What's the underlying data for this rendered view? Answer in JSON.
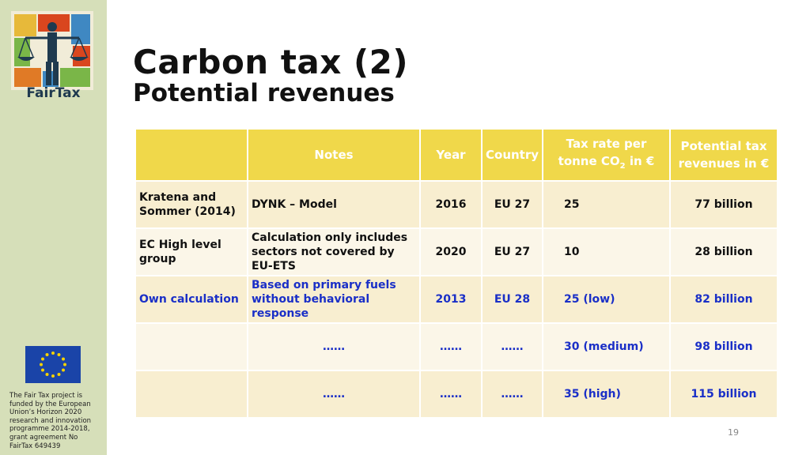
{
  "sidebar": {
    "logo_text": "FairTax",
    "funding_text": "The Fair Tax project is funded by the European Union’s Horizon 2020 research and innovation programme 2014-2018, grant agreement No FairTax 649439"
  },
  "header": {
    "title": "Carbon tax (2)",
    "subtitle": "Potential revenues"
  },
  "table": {
    "headers": {
      "col0": "",
      "notes": "Notes",
      "year": "Year",
      "country": "Country",
      "tax_rate_line1": "Tax rate per",
      "tax_rate_line2_pre": "tonne CO",
      "tax_rate_sub": "2",
      "tax_rate_line2_post": " in €",
      "revenues_line1": "Potential tax",
      "revenues_line2": "revenues in €"
    },
    "rows": [
      {
        "source": "Kratena and Sommer (2014)",
        "notes": "DYNK – Model",
        "year": "2016",
        "country": "EU 27",
        "tax_rate": "25",
        "revenues": "77 billion"
      },
      {
        "source": "EC High level group",
        "notes": "Calculation only includes sectors not covered by EU-ETS",
        "year": "2020",
        "country": "EU 27",
        "tax_rate": "10",
        "revenues": "28 billion"
      },
      {
        "source": "Own calculation",
        "notes": "Based on primary fuels without behavioral response",
        "year": "2013",
        "country": "EU 28",
        "tax_rate": "25 (low)",
        "revenues": "82 billion"
      },
      {
        "source": "",
        "notes": "……",
        "year": "……",
        "country": "……",
        "tax_rate": "30 (medium)",
        "revenues": "98 billion"
      },
      {
        "source": "",
        "notes": "……",
        "year": "……",
        "country": "……",
        "tax_rate": "35 (high)",
        "revenues": "115 billion"
      }
    ]
  },
  "footer": {
    "page_number": "19"
  },
  "colors": {
    "header_yellow": "#f0d84a",
    "sidebar_green": "#d6dfb9",
    "highlight_blue": "#1a2fc7",
    "row_cream": "#f8eed0"
  }
}
